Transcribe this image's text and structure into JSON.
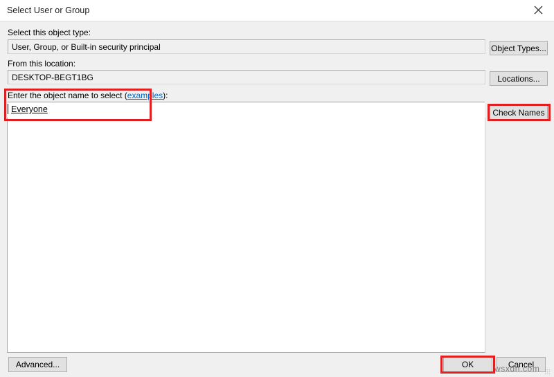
{
  "window": {
    "title": "Select User or Group",
    "close_icon": "close-icon"
  },
  "object_type": {
    "label": "Select this object type:",
    "value": "User, Group, or Built-in security principal",
    "button_label": "Object Types..."
  },
  "location": {
    "label": "From this location:",
    "value": "DESKTOP-BEGT1BG",
    "button_label": "Locations..."
  },
  "object_name": {
    "label_prefix": "Enter the object name to select (",
    "label_link": "examples",
    "label_suffix": "):",
    "value": "Everyone",
    "placeholder": "",
    "button_label": "Check Names"
  },
  "footer": {
    "advanced_label": "Advanced...",
    "ok_label": "OK",
    "cancel_label": "Cancel"
  },
  "watermark": {
    "text": "wsxdn.com"
  },
  "annotations": {
    "accent_color": "#e02020",
    "items": [
      {
        "name": "annotation-object-name-field"
      },
      {
        "name": "annotation-check-names-button"
      },
      {
        "name": "annotation-ok-button"
      }
    ]
  }
}
